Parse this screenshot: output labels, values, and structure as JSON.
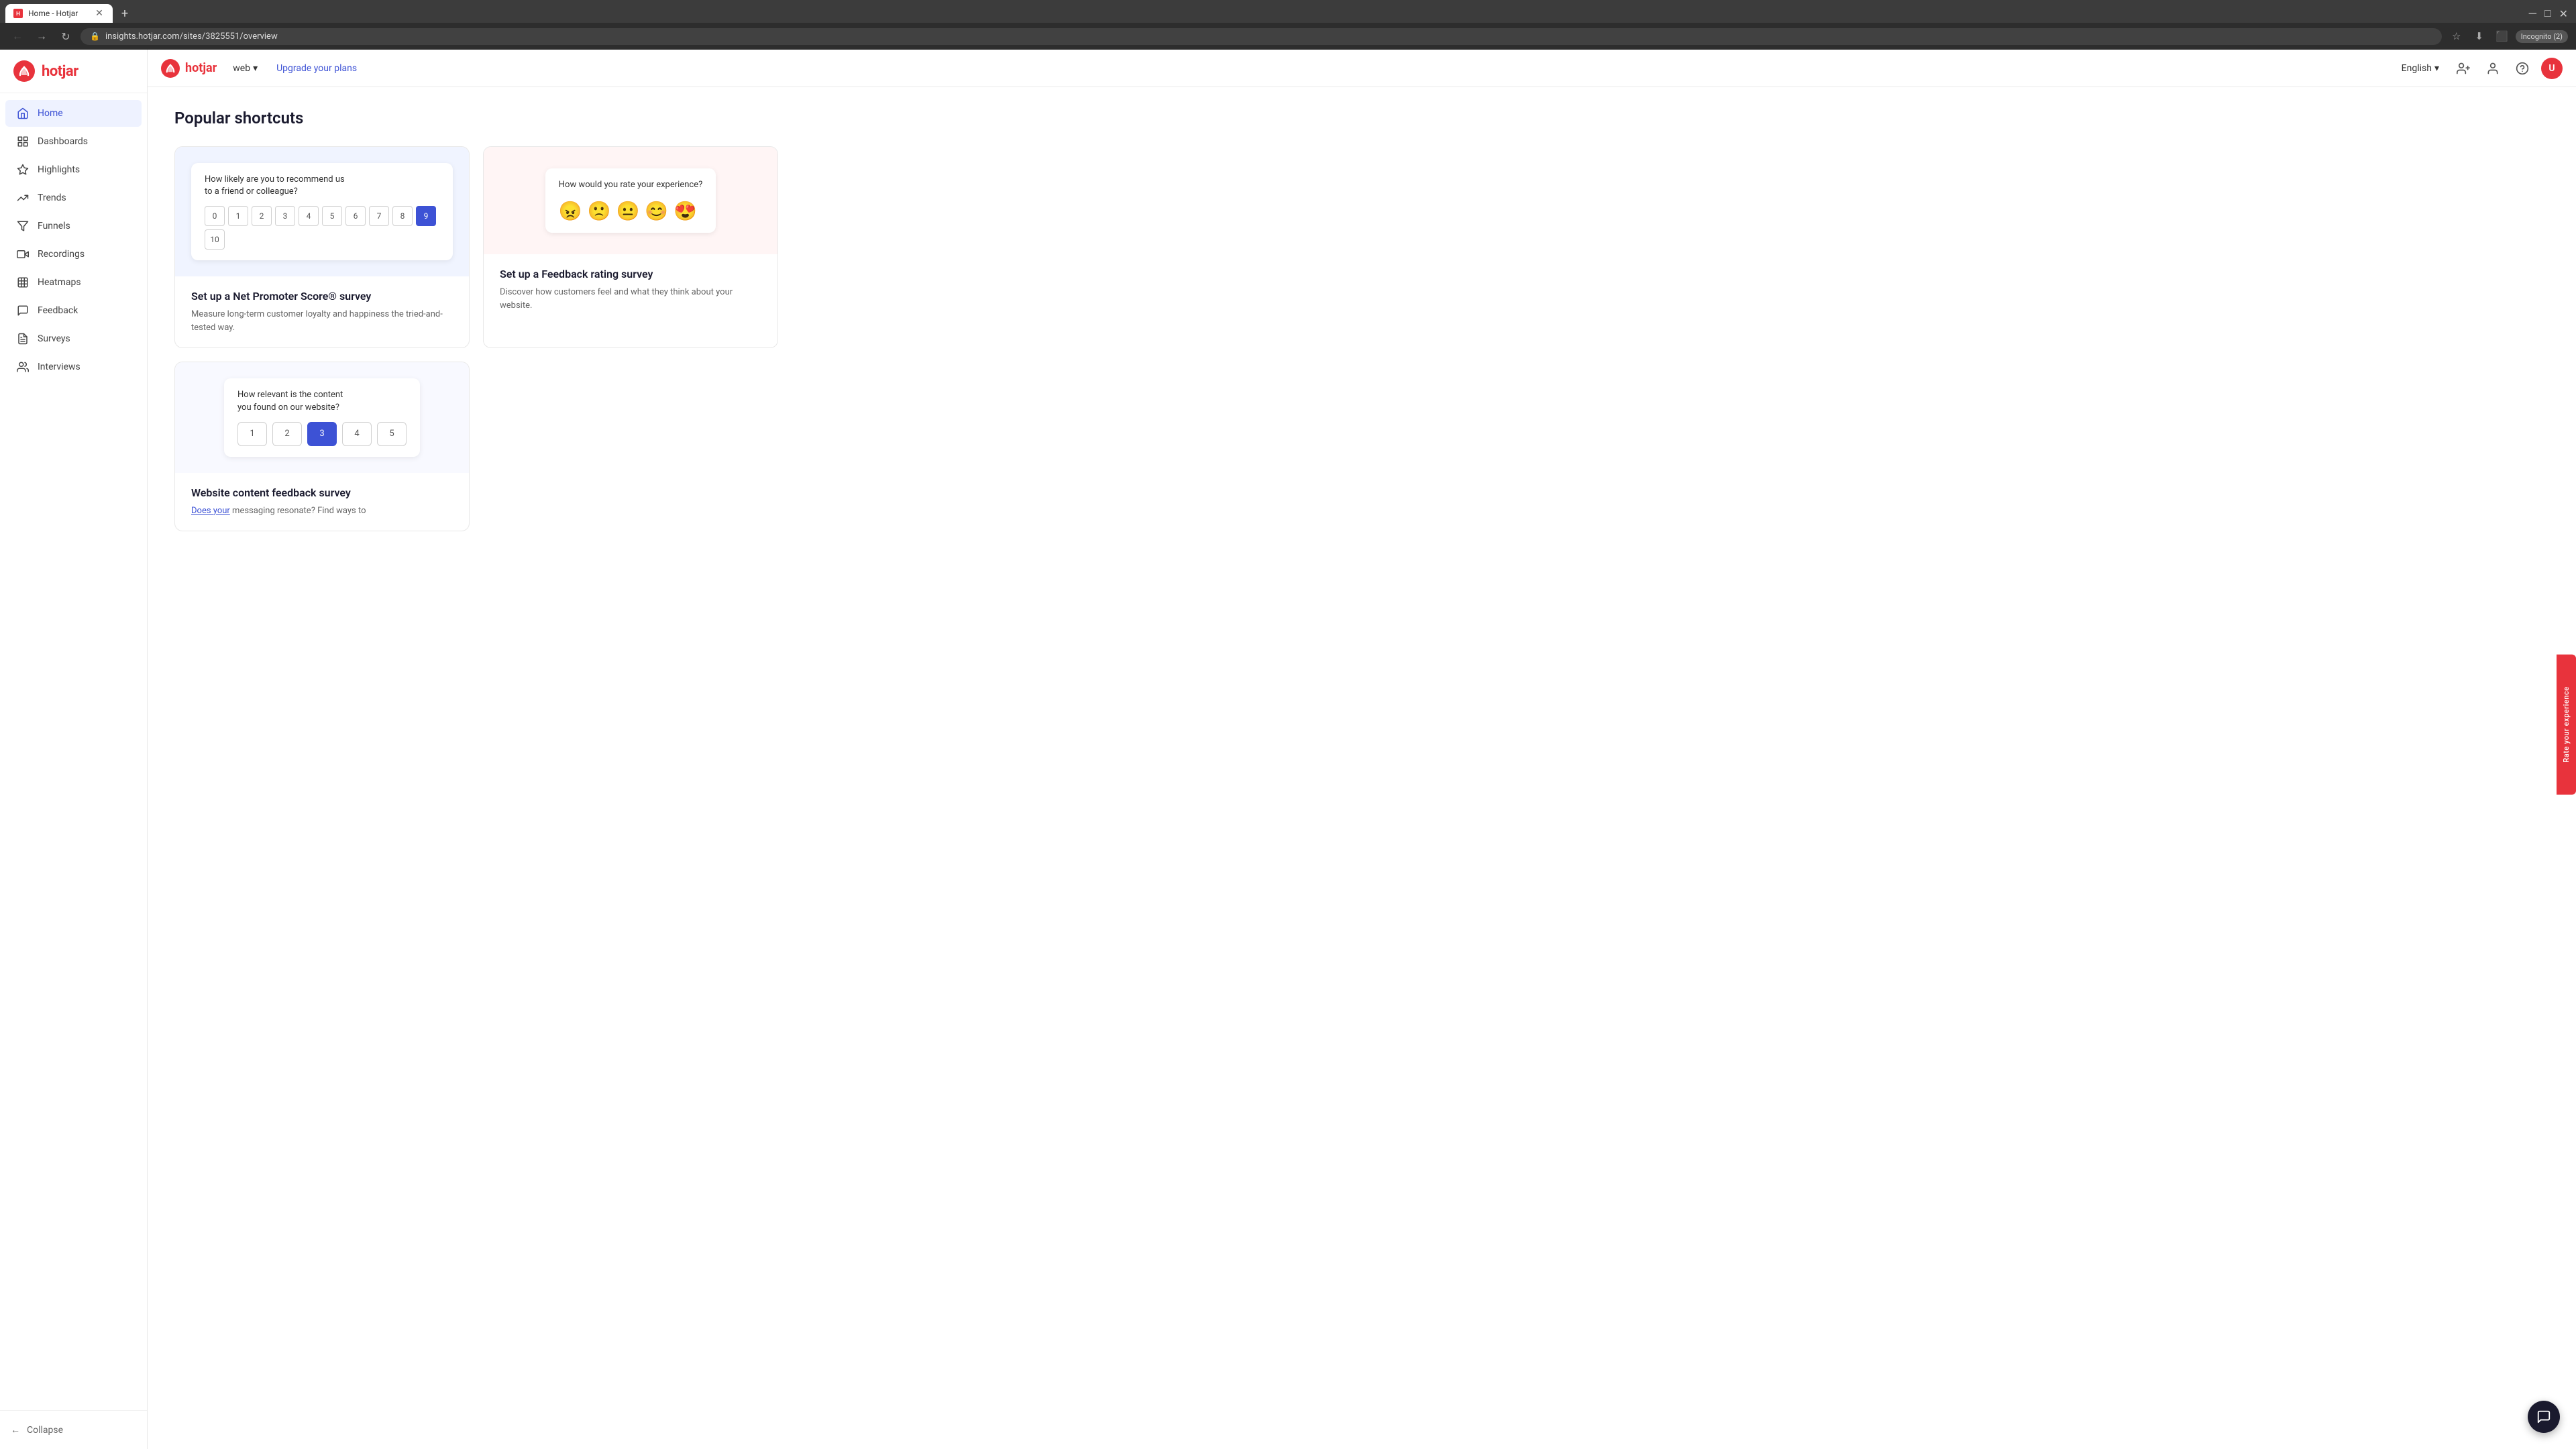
{
  "browser": {
    "tab_title": "Home - Hotjar",
    "tab_favicon": "H",
    "url": "insights.hotjar.com/sites/3825551/overview",
    "incognito_label": "Incognito (2)",
    "new_tab_label": "+"
  },
  "topbar": {
    "brand": "hotjar",
    "web_label": "web",
    "upgrade_label": "Upgrade your plans",
    "language": "English",
    "chevron": "▾"
  },
  "sidebar": {
    "items": [
      {
        "label": "Home",
        "active": true,
        "icon": "home"
      },
      {
        "label": "Dashboards",
        "active": false,
        "icon": "dashboard"
      },
      {
        "label": "Highlights",
        "active": false,
        "icon": "highlights"
      },
      {
        "label": "Trends",
        "active": false,
        "icon": "trends"
      },
      {
        "label": "Funnels",
        "active": false,
        "icon": "funnels"
      },
      {
        "label": "Recordings",
        "active": false,
        "icon": "recordings"
      },
      {
        "label": "Heatmaps",
        "active": false,
        "icon": "heatmaps"
      },
      {
        "label": "Feedback",
        "active": false,
        "icon": "feedback"
      },
      {
        "label": "Surveys",
        "active": false,
        "icon": "surveys"
      },
      {
        "label": "Interviews",
        "active": false,
        "icon": "interviews"
      }
    ],
    "collapse_label": "Collapse"
  },
  "main": {
    "page_title": "Popular shortcuts",
    "cards": [
      {
        "id": "nps",
        "preview_type": "nps",
        "title": "Set up a Net Promoter Score® survey",
        "description": "Measure long-term customer loyalty and happiness the tried-and-tested way.",
        "survey_question": "How likely are you to recommend us to a friend or colleague?",
        "nps_values": [
          "0",
          "1",
          "2",
          "3",
          "4",
          "5",
          "6",
          "7",
          "8",
          "9",
          "10"
        ],
        "nps_selected": "9",
        "preview_bg": "light"
      },
      {
        "id": "feedback-rating",
        "preview_type": "emoji",
        "title": "Set up a Feedback rating survey",
        "description": "Discover how customers feel and what they think about your website.",
        "survey_question": "How would you rate your experience?",
        "emojis": [
          "😠",
          "🙁",
          "😐",
          "😊",
          "😍"
        ],
        "preview_bg": "pink"
      },
      {
        "id": "content-feedback",
        "preview_type": "content",
        "title": "Website content feedback survey",
        "description": "Does your messaging resonate? Find ways to",
        "survey_question": "How relevant is the content you found on our website?",
        "content_values": [
          "1",
          "2",
          "3",
          "4",
          "5"
        ],
        "content_selected": "3",
        "preview_bg": "light"
      }
    ]
  },
  "rate_experience": "Rate your experience",
  "chat_icon": "💬"
}
